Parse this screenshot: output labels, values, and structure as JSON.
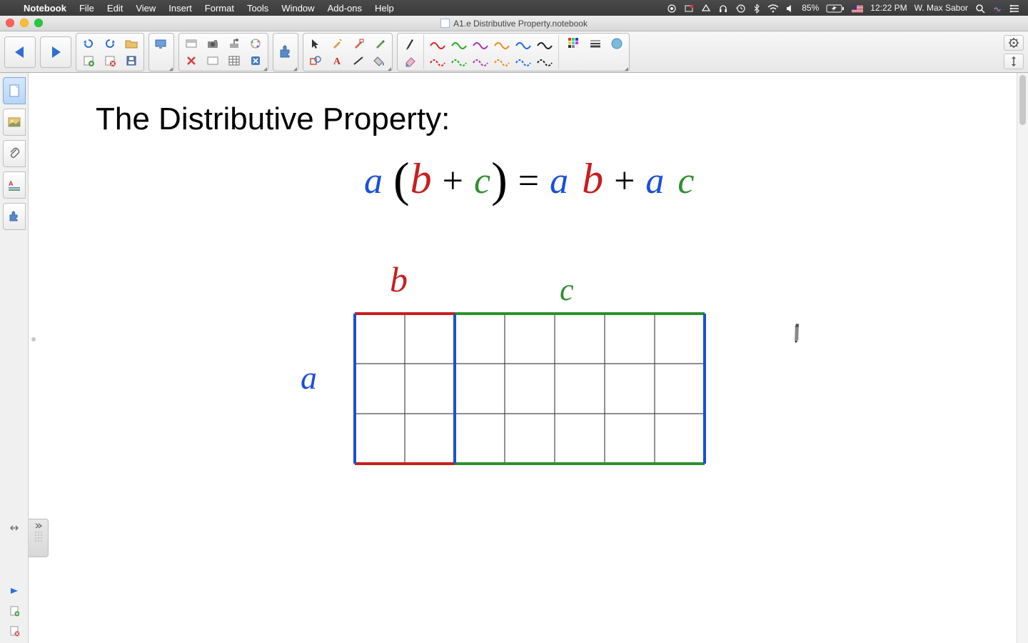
{
  "menubar": {
    "app": "Notebook",
    "items": [
      "File",
      "Edit",
      "View",
      "Insert",
      "Format",
      "Tools",
      "Window",
      "Add-ons",
      "Help"
    ],
    "battery": "85%",
    "clock": "12:22 PM",
    "user": "W. Max Sabor"
  },
  "window": {
    "title": "A1.e Distributive Property.notebook"
  },
  "content": {
    "heading": "The Distributive Property:",
    "eq": {
      "a": "a",
      "b": "b",
      "c": "c",
      "plus": "+",
      "eq": "=",
      "lp": "(",
      "rp": ")"
    },
    "labels": {
      "a": "a",
      "b": "b",
      "c": "c"
    }
  },
  "chart_data": {
    "type": "table",
    "title": "Area model for a(b+c)",
    "rows": 3,
    "segments": [
      {
        "name": "b",
        "cols": 2,
        "top_color": "#c81e1e",
        "bottom_color": "#c81e1e"
      },
      {
        "name": "c",
        "cols": 5,
        "top_color": "#2f8f2f",
        "bottom_color": "#2f8f2f"
      }
    ],
    "cell_size": 70,
    "left_color": "#1a4fd8",
    "right_color": "#1a4fd8",
    "mid_color": "#1a4fd8",
    "grid_color": "#4a4a4a"
  }
}
